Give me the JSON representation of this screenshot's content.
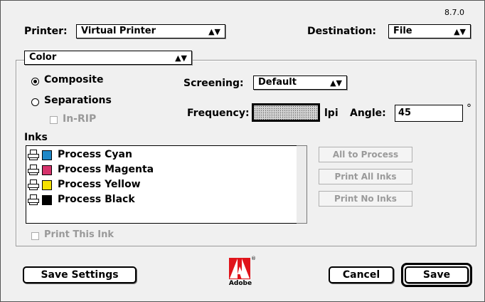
{
  "version": "8.7.0",
  "printer": {
    "label": "Printer:",
    "value": "Virtual Printer"
  },
  "destination": {
    "label": "Destination:",
    "value": "File"
  },
  "panel": {
    "value": "Color"
  },
  "output": {
    "composite_label": "Composite",
    "separations_label": "Separations",
    "inrip_label": "In-RIP",
    "selected": "Composite"
  },
  "screening": {
    "label": "Screening:",
    "value": "Default"
  },
  "frequency": {
    "label": "Frequency:",
    "unit": "lpi"
  },
  "angle": {
    "label": "Angle:",
    "value": "45",
    "unit": "°"
  },
  "inks": {
    "label": "Inks",
    "items": [
      {
        "name": "Process Cyan",
        "color": "#1e88c8"
      },
      {
        "name": "Process Magenta",
        "color": "#d6336c"
      },
      {
        "name": "Process Yellow",
        "color": "#f5e100"
      },
      {
        "name": "Process Black",
        "color": "#000000"
      }
    ],
    "print_this_ink_label": "Print This Ink"
  },
  "ink_buttons": {
    "all_to_process": "All to Process",
    "print_all_inks": "Print All Inks",
    "print_no_inks": "Print No Inks"
  },
  "footer": {
    "save_settings": "Save Settings",
    "cancel": "Cancel",
    "save": "Save",
    "logo_text": "Adobe"
  }
}
